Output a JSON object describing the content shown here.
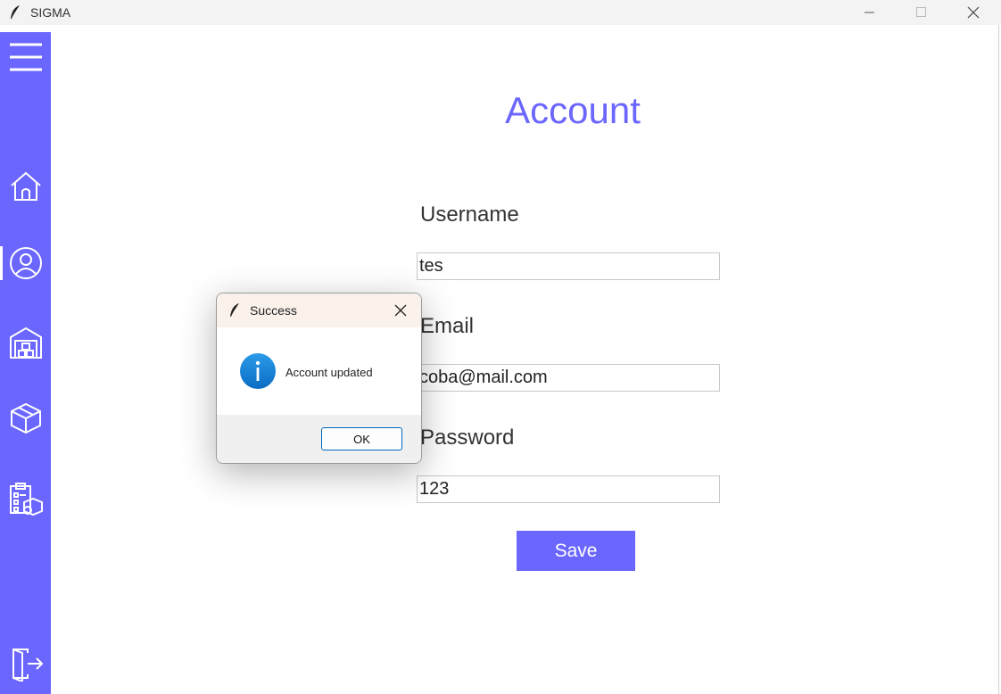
{
  "window": {
    "title": "SIGMA"
  },
  "sidebar": {
    "items": [
      {
        "icon": "menu-icon"
      },
      {
        "icon": "home-icon"
      },
      {
        "icon": "user-circle-icon"
      },
      {
        "icon": "warehouse-icon"
      },
      {
        "icon": "package-box-icon"
      },
      {
        "icon": "clipboard-inventory-icon"
      },
      {
        "icon": "logout-icon"
      }
    ],
    "active_item": "user-circle-icon"
  },
  "page": {
    "title": "Account",
    "username_label": "Username",
    "username_value": "tes",
    "email_label": "Email",
    "email_value": "coba@mail.com",
    "password_label": "Password",
    "password_value": "123",
    "save_label": "Save"
  },
  "dialog": {
    "title": "Success",
    "message": "Account updated",
    "ok_label": "OK",
    "icon": "info-icon"
  },
  "colors": {
    "accent": "#6b66fe",
    "info": "#0a78d4"
  }
}
